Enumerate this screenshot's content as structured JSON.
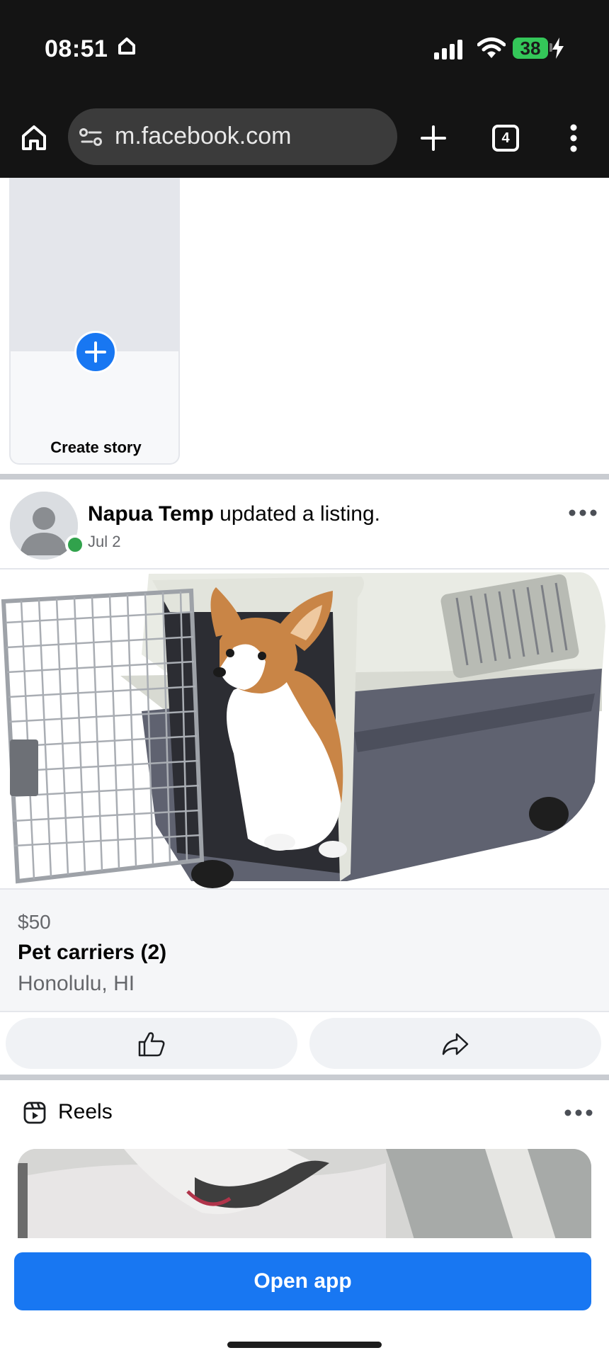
{
  "status_bar": {
    "time": "08:51",
    "battery": "38"
  },
  "browser": {
    "url": "m.facebook.com",
    "tab_count": "4"
  },
  "stories": {
    "create_label": "Create story"
  },
  "post": {
    "author": "Napua Temp",
    "action_text": " updated a listing.",
    "date": "Jul 2",
    "listing": {
      "price": "$50",
      "title": "Pet carriers (2)",
      "location": "Honolulu, HI"
    }
  },
  "reels": {
    "label": "Reels"
  },
  "bottom": {
    "open_app_label": "Open app"
  },
  "colors": {
    "brand": "#1877f2",
    "online": "#31a24c",
    "battery": "#34c759"
  }
}
